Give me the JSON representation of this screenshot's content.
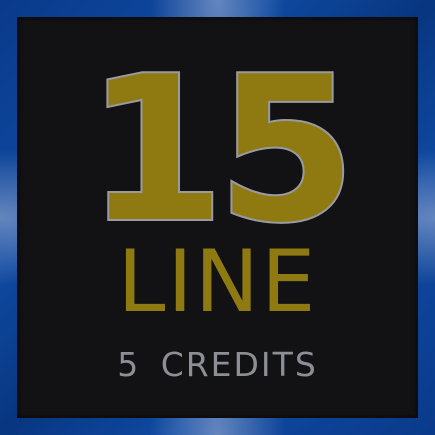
{
  "badge": {
    "number": "15",
    "label": "LINE",
    "credits": "5 CREDITS"
  },
  "colors": {
    "frame_blue": "#0f4aa3",
    "panel_bg": "#121214",
    "gold": "#8f7a12",
    "gray": "#8e8e96"
  }
}
